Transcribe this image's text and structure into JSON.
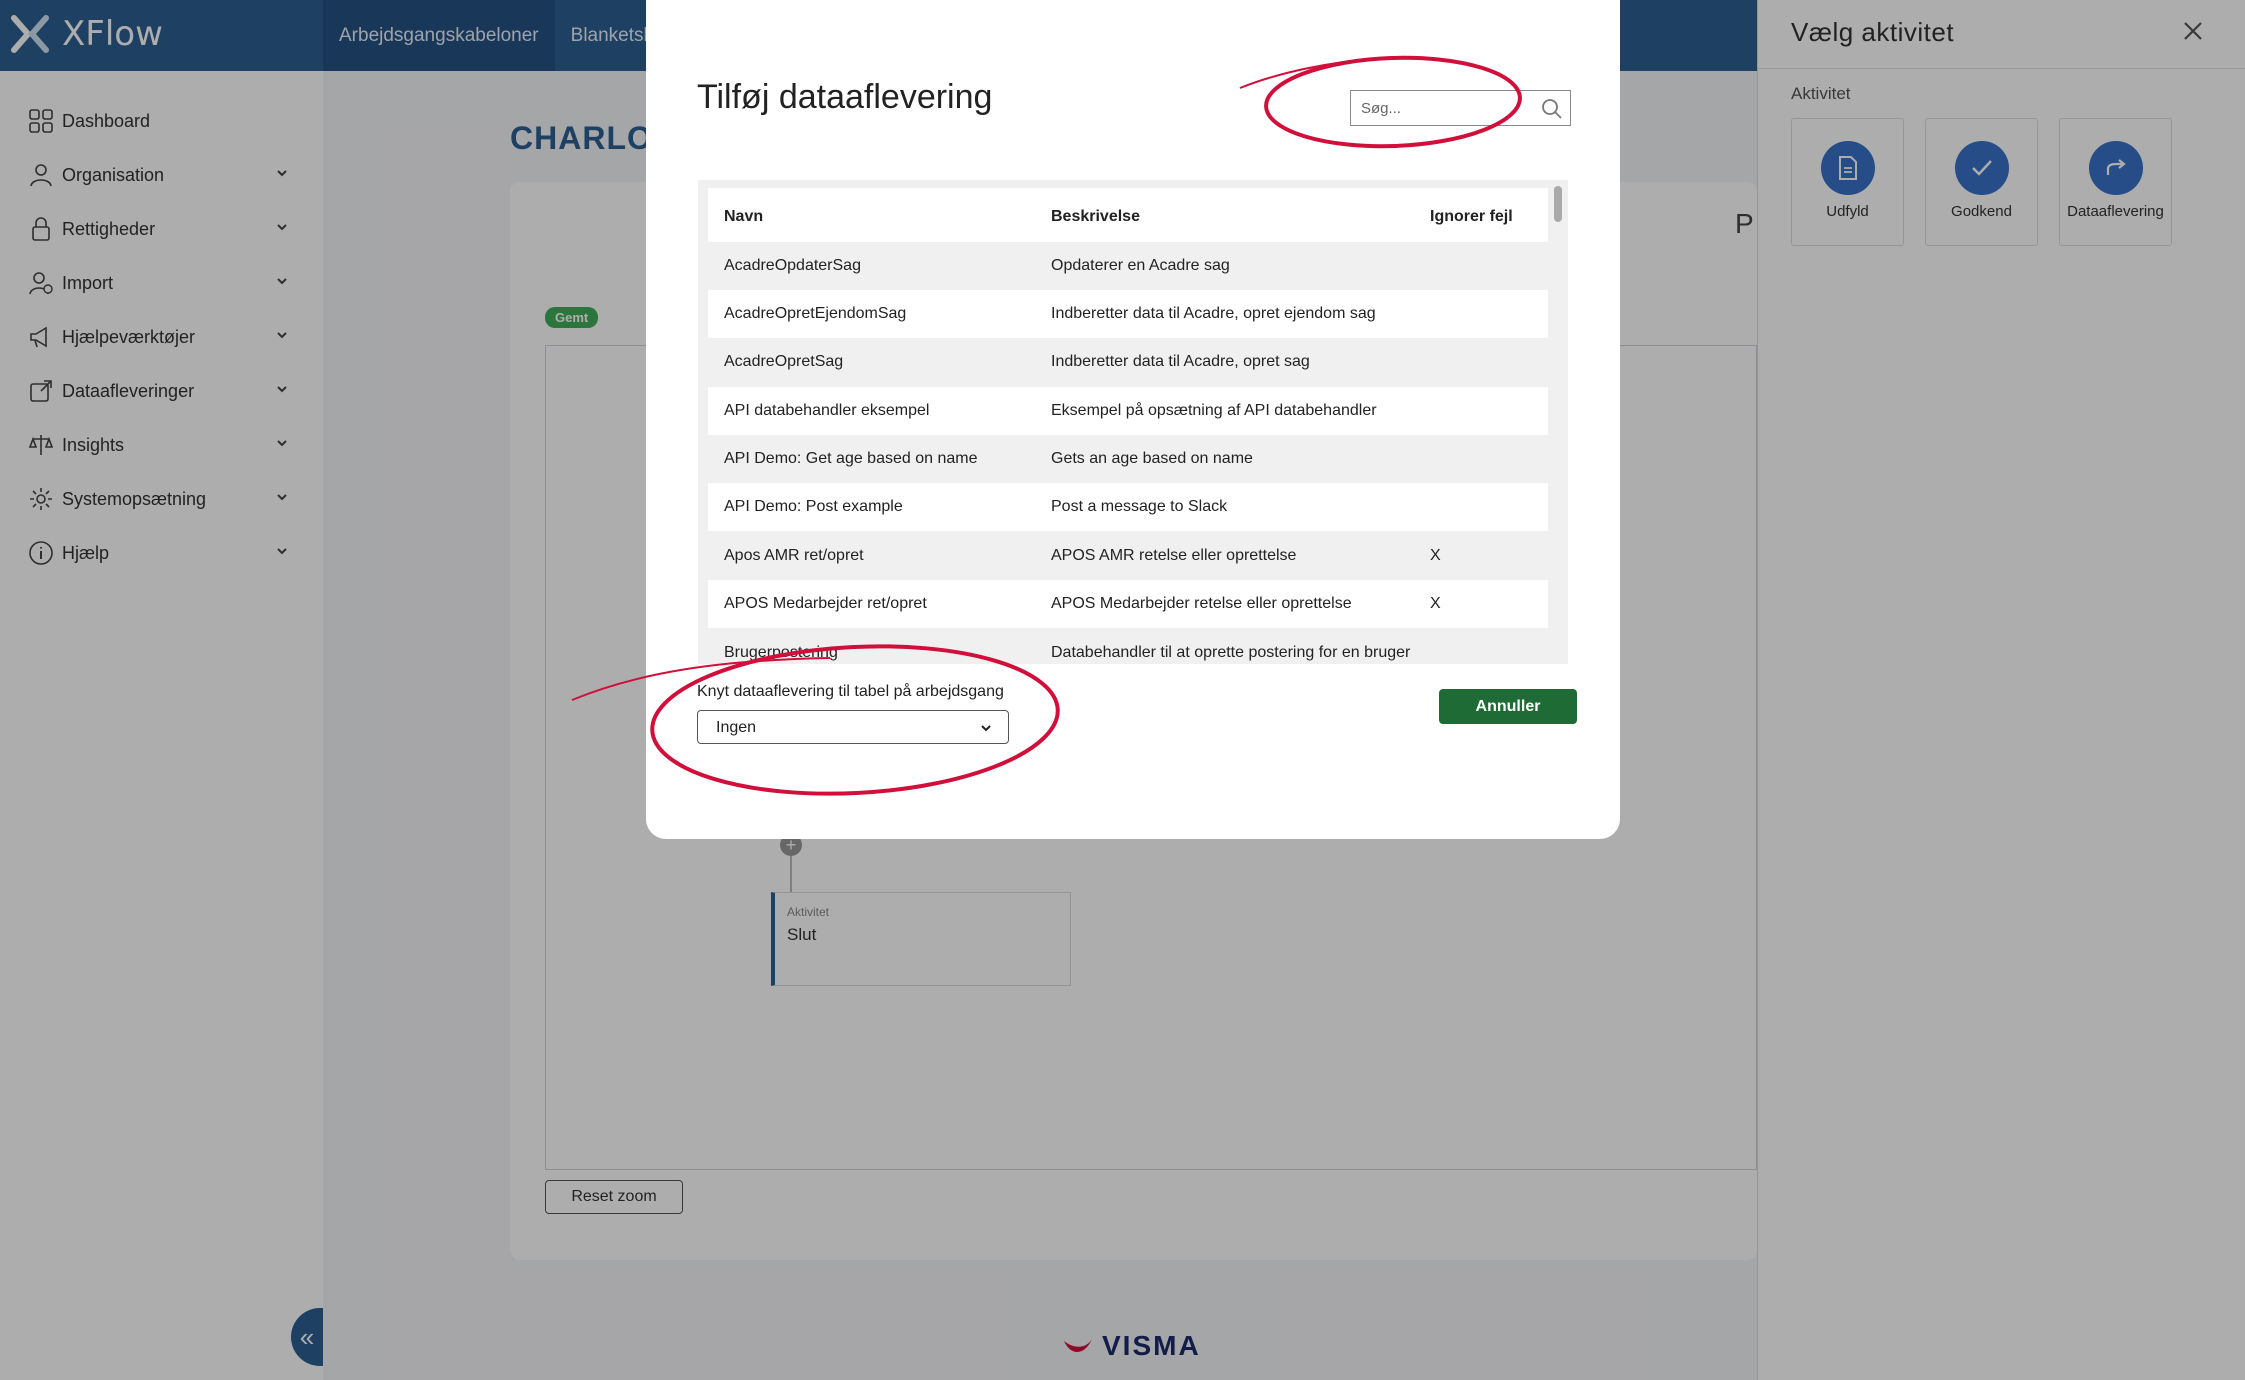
{
  "app": {
    "name": "XFlow"
  },
  "top_tabs": [
    {
      "label": "Arbejdsgangskabeloner"
    },
    {
      "label": "Blanketska"
    }
  ],
  "sidebar": {
    "items": [
      {
        "label": "Dashboard",
        "icon": "dashboard-icon"
      },
      {
        "label": "Organisation",
        "icon": "organisation-icon"
      },
      {
        "label": "Rettigheder",
        "icon": "lock-icon"
      },
      {
        "label": "Import",
        "icon": "import-icon"
      },
      {
        "label": "Hjælpeværktøjer",
        "icon": "megaphone-icon"
      },
      {
        "label": "Dataafleveringer",
        "icon": "export-icon"
      },
      {
        "label": "Insights",
        "icon": "scale-icon"
      },
      {
        "label": "Systemopsætning",
        "icon": "gear-icon"
      },
      {
        "label": "Hjælp",
        "icon": "info-icon"
      }
    ],
    "collapse_label": "«"
  },
  "main": {
    "heading": "CHARLO",
    "saved_badge": "Gemt",
    "activity_box": {
      "label": "Aktivitet",
      "value": "Slut"
    },
    "reset_zoom": "Reset zoom",
    "peek_letter": "P"
  },
  "footer": {
    "brand": "VISMA"
  },
  "right_panel": {
    "title": "Vælg aktivitet",
    "section": "Aktivitet",
    "tiles": [
      {
        "label": "Udfyld",
        "icon": "document-icon"
      },
      {
        "label": "Godkend",
        "icon": "check-icon"
      },
      {
        "label": "Dataaflevering",
        "icon": "share-arrow-icon"
      }
    ]
  },
  "modal": {
    "title": "Tilføj dataaflevering",
    "search_placeholder": "Søg...",
    "columns": [
      "Navn",
      "Beskrivelse",
      "Ignorer fejl"
    ],
    "rows": [
      {
        "name": "AcadreOpdaterSag",
        "desc": "Opdaterer en Acadre sag",
        "ignore": ""
      },
      {
        "name": "AcadreOpretEjendomSag",
        "desc": "Indberetter data til Acadre, opret ejendom sag",
        "ignore": ""
      },
      {
        "name": "AcadreOpretSag",
        "desc": "Indberetter data til Acadre, opret sag",
        "ignore": ""
      },
      {
        "name": "API databehandler eksempel",
        "desc": "Eksempel på opsætning af API databehandler",
        "ignore": ""
      },
      {
        "name": "API Demo: Get age based on name",
        "desc": "Gets an age based on name",
        "ignore": ""
      },
      {
        "name": "API Demo: Post example",
        "desc": "Post a message to Slack",
        "ignore": ""
      },
      {
        "name": "Apos AMR ret/opret",
        "desc": "APOS AMR retelse eller oprettelse",
        "ignore": "X"
      },
      {
        "name": "APOS Medarbejder ret/opret",
        "desc": "APOS Medarbejder retelse eller oprettelse",
        "ignore": "X"
      },
      {
        "name": "Brugerpostering",
        "desc": "Databehandler til at oprette postering for en bruger",
        "ignore": ""
      }
    ],
    "link_label": "Knyt dataaflevering til tabel på arbejdsgang",
    "link_value": "Ingen",
    "cancel_label": "Annuller"
  },
  "colors": {
    "brand_blue": "#2b5f93",
    "action_green": "#1f6b35",
    "annotation_red": "#d0103a",
    "tile_blue": "#3a72c9"
  }
}
